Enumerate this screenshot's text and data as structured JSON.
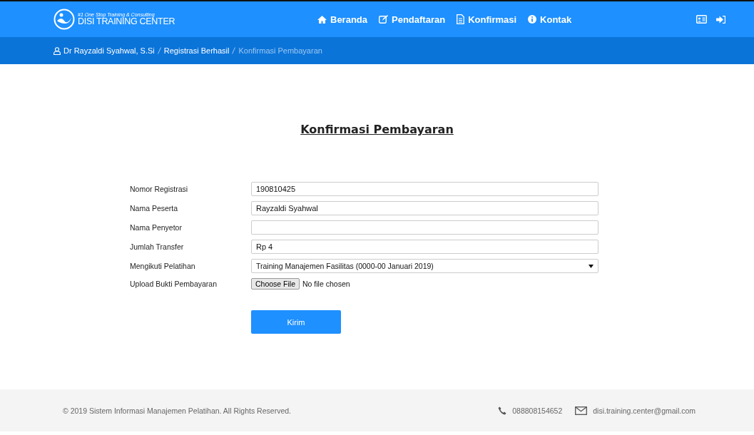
{
  "brand": {
    "tagline": "#1 One Stop Training & Consulting",
    "title": "DISI TRAINING CENTER"
  },
  "nav": [
    {
      "label": "Beranda"
    },
    {
      "label": "Pendaftaran"
    },
    {
      "label": "Konfirmasi"
    },
    {
      "label": "Kontak"
    }
  ],
  "breadcrumb": [
    {
      "label": "Dr Rayzaldi Syahwal, S.Si",
      "selected": false
    },
    {
      "label": "Registrasi Berhasil",
      "selected": false
    },
    {
      "label": "Konfirmasi Pembayaran",
      "selected": true
    }
  ],
  "page_title": "Konfirmasi Pembayaran",
  "form": [
    {
      "kind": "text",
      "label": "Nomor Registrasi",
      "value": "190810425"
    },
    {
      "kind": "text",
      "label": "Nama Peserta",
      "value": "Rayzaldi Syahwal"
    },
    {
      "kind": "text",
      "label": "Nama Penyetor"
    },
    {
      "kind": "text",
      "label": "Jumlah Transfer",
      "value": "Rp 4"
    },
    {
      "kind": "select",
      "label": "Mengikuti Pelatihan",
      "value": "Training Manajemen Fasilitas (0000-00 Januari 2019)"
    },
    {
      "kind": "file",
      "label": "Upload Bukti Pembayaran",
      "button": "Choose File",
      "status": "No file chosen"
    }
  ],
  "submit": "Kirim",
  "footer": {
    "copyright": "© 2019 Sistem Informasi Manajemen Pelatihan. All Rights Reserved.",
    "phone": "088808154652",
    "email": "disi.training.center@gmail.com"
  }
}
